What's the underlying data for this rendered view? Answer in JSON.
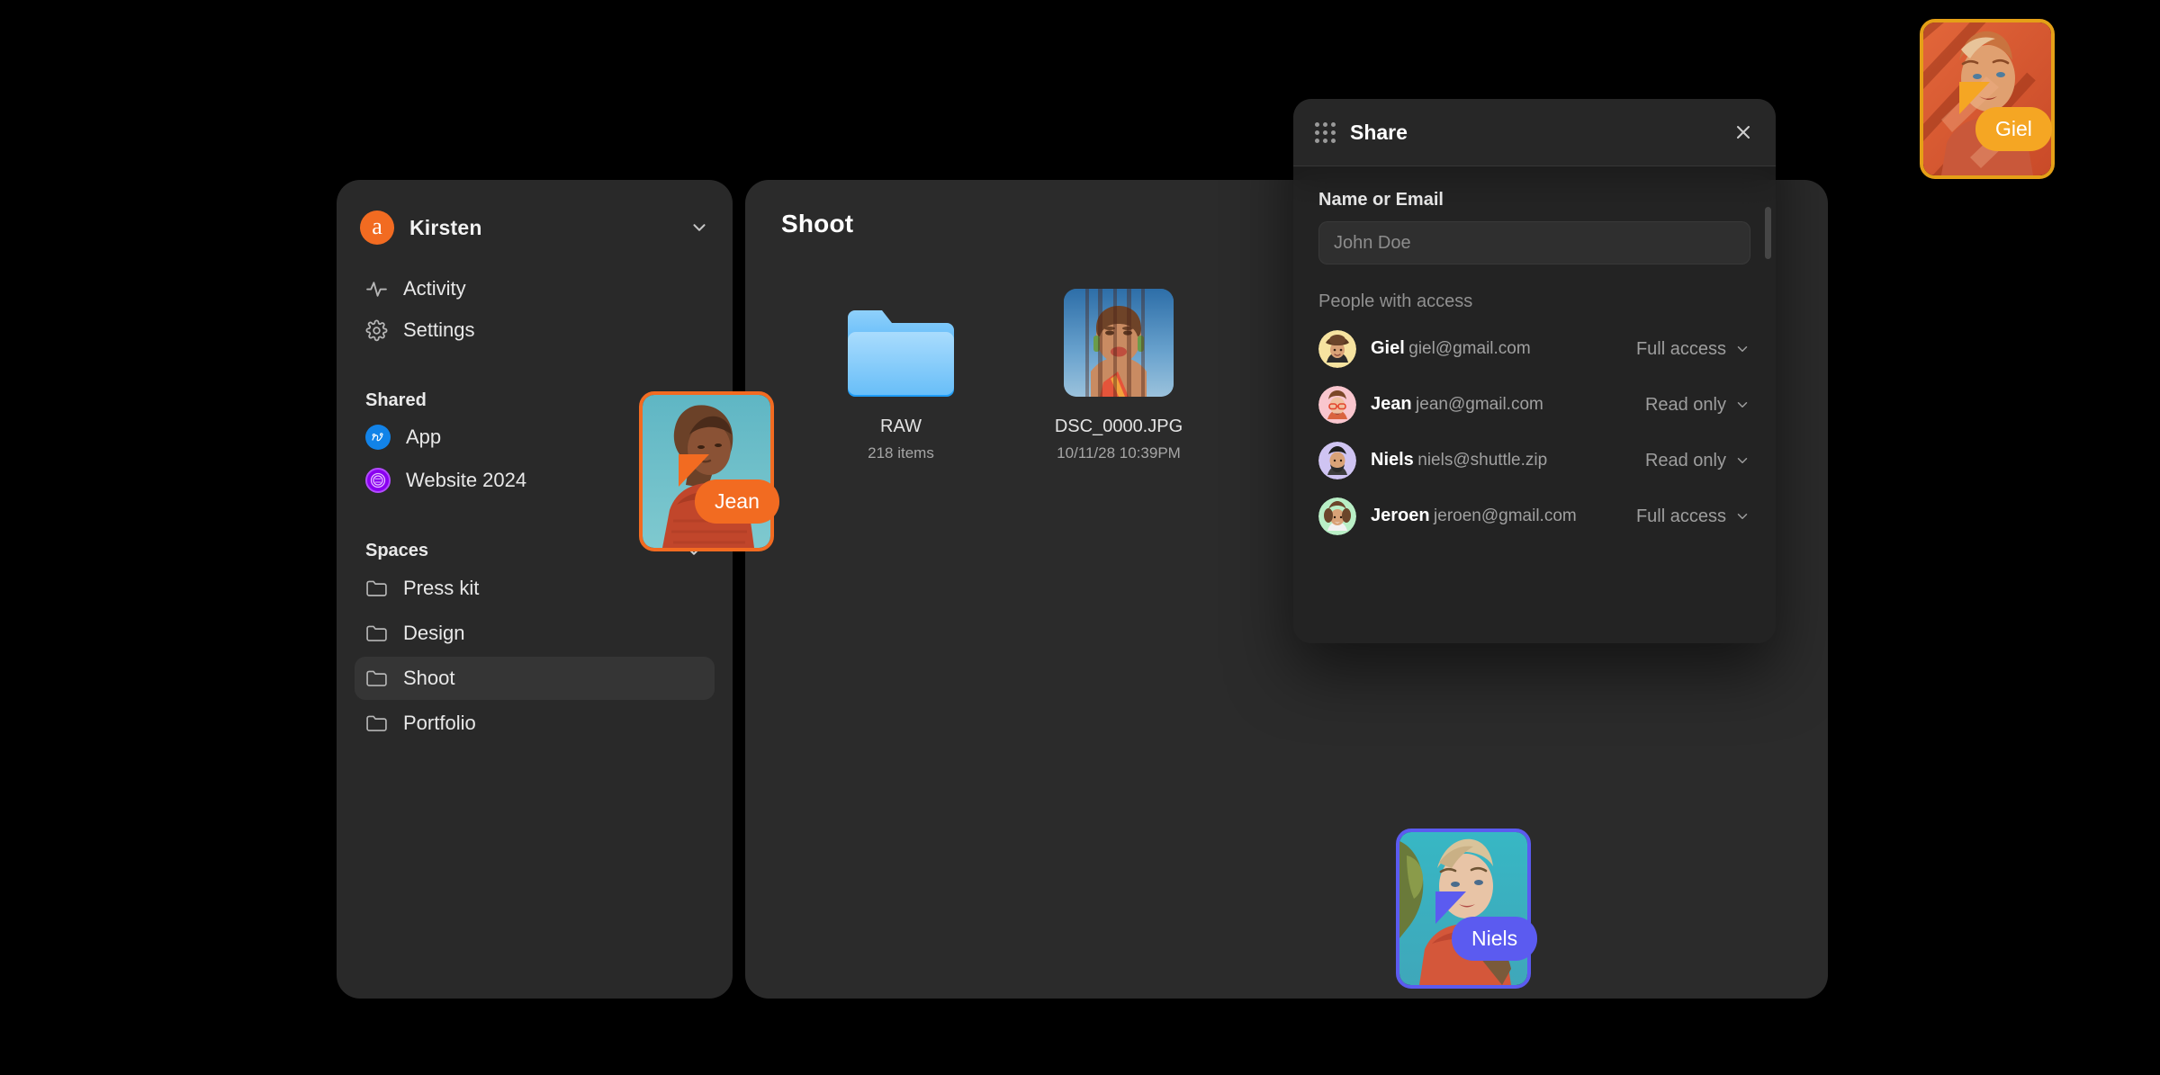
{
  "theme": {
    "background": "#000000",
    "window_bg": "#292929",
    "main_window_bg": "#2B2B2B",
    "accent_orange": "#F26B21",
    "accent_blue": "#5B5BF0",
    "accent_amber": "#E5A017",
    "text_primary": "#FFFFFF",
    "text_secondary": "#A0A0A0"
  },
  "sidebar": {
    "account": {
      "name": "Kirsten",
      "avatar_letter": "a",
      "avatar_color": "#F26B21",
      "chevron_icon": "chevron-down-icon"
    },
    "nav": [
      {
        "label": "Activity",
        "icon": "activity-pulse-icon"
      },
      {
        "label": "Settings",
        "icon": "gear-icon"
      }
    ],
    "shared": {
      "heading": "Shared",
      "items": [
        {
          "label": "App",
          "icon": "app-badge-icon",
          "color": "#1283E8"
        },
        {
          "label": "Website 2024",
          "icon": "website-stamp-icon",
          "color": "#8A00F0"
        }
      ]
    },
    "spaces": {
      "heading": "Spaces",
      "chevron_icon": "chevron-down-icon",
      "items": [
        {
          "label": "Press kit",
          "icon": "folder-icon",
          "active": false
        },
        {
          "label": "Design",
          "icon": "folder-icon",
          "active": false
        },
        {
          "label": "Shoot",
          "icon": "folder-icon",
          "active": true
        },
        {
          "label": "Portfolio",
          "icon": "folder-icon",
          "active": false
        }
      ]
    }
  },
  "main": {
    "title": "Shoot",
    "files": [
      {
        "name": "RAW",
        "sub": "218 items",
        "kind": "folder",
        "icon": "blue-folder-icon"
      },
      {
        "name": "DSC_0000.JPG",
        "sub": "10/11/28 10:39PM",
        "kind": "image",
        "icon": "photo-thumbnail"
      }
    ]
  },
  "share_dialog": {
    "title": "Share",
    "drag_handle_icon": "grid-dots-icon",
    "close_icon": "close-icon",
    "field": {
      "label": "Name or Email",
      "placeholder": "John Doe",
      "value": ""
    },
    "people_heading": "People with access",
    "people": [
      {
        "name": "Giel",
        "email": "giel@gmail.com",
        "access": "Full access",
        "avatar_bg": "#F6E3A0",
        "chevron_icon": "chevron-down-icon"
      },
      {
        "name": "Jean",
        "email": "jean@gmail.com",
        "access": "Read only",
        "avatar_bg": "#F9C6CE",
        "chevron_icon": "chevron-down-icon"
      },
      {
        "name": "Niels",
        "email": "niels@shuttle.zip",
        "access": "Read only",
        "avatar_bg": "#CFC4F2",
        "chevron_icon": "chevron-down-icon"
      },
      {
        "name": "Jeroen",
        "email": "jeroen@gmail.com",
        "access": "Full access",
        "avatar_bg": "#B9EFC6",
        "chevron_icon": "chevron-down-icon"
      }
    ]
  },
  "cursors": [
    {
      "name": "Jean",
      "color": "#F26B21"
    },
    {
      "name": "Niels",
      "color": "#5B5BF0"
    },
    {
      "name": "Giel",
      "color": "#E5A017"
    }
  ]
}
